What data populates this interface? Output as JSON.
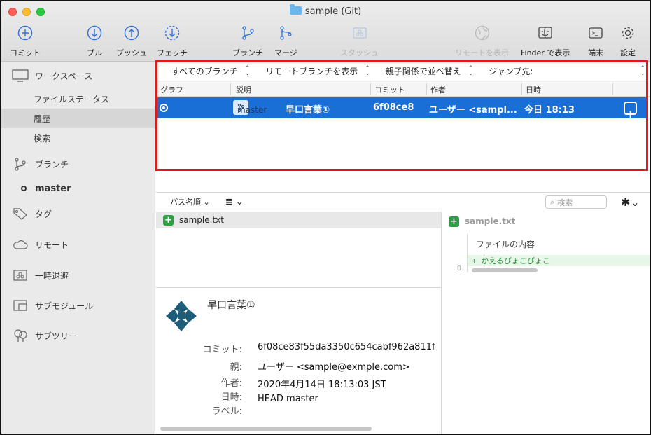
{
  "window": {
    "title": "sample (Git)"
  },
  "toolbar": {
    "commit": "コミット",
    "pull": "プル",
    "push": "プッシュ",
    "fetch": "フェッチ",
    "branch": "ブランチ",
    "merge": "マージ",
    "stash": "スタッシュ",
    "show_remote": "リモートを表示",
    "show_finder": "Finder で表示",
    "terminal": "端末",
    "settings": "設定"
  },
  "sidebar": {
    "workspace": "ワークスペース",
    "file_status": "ファイルステータス",
    "history": "履歴",
    "search": "検索",
    "branches": "ブランチ",
    "current_branch": "master",
    "tags": "タグ",
    "remotes": "リモート",
    "stashes": "一時退避",
    "submodules": "サブモジュール",
    "subtrees": "サブツリー"
  },
  "filters": {
    "branches": "すべてのブランチ",
    "remote": "リモートブランチを表示",
    "order": "親子関係で並べ替え",
    "jump": "ジャンプ先:"
  },
  "columns": {
    "graph": "グラフ",
    "description": "説明",
    "commit": "コミット",
    "author": "作者",
    "date": "日時"
  },
  "commit_row": {
    "branch_tag": "master",
    "message": "早口言葉①",
    "hash": "6f08ce8",
    "author": "ユーザー <sampl...",
    "date": "今日 18:13"
  },
  "lower": {
    "sort": "パス名順",
    "search_placeholder": "検索",
    "file": "sample.txt"
  },
  "details": {
    "title": "早口言葉①",
    "commit_label": "コミット:",
    "commit_value": "6f08ce83f55da3350c654cabf962a811f",
    "parent_label": "親:",
    "parent_value": "ユーザー <sample@exmple.com>",
    "author_label": "作者:",
    "author_value": "2020年4月14日 18:13:03 JST",
    "date_label": "日時:",
    "date_value": "HEAD master",
    "labels_label": "ラベル:"
  },
  "diff": {
    "file": "sample.txt",
    "section": "ファイルの内容",
    "line_no": "0",
    "line": "+ かえるぴょこぴょこ"
  }
}
